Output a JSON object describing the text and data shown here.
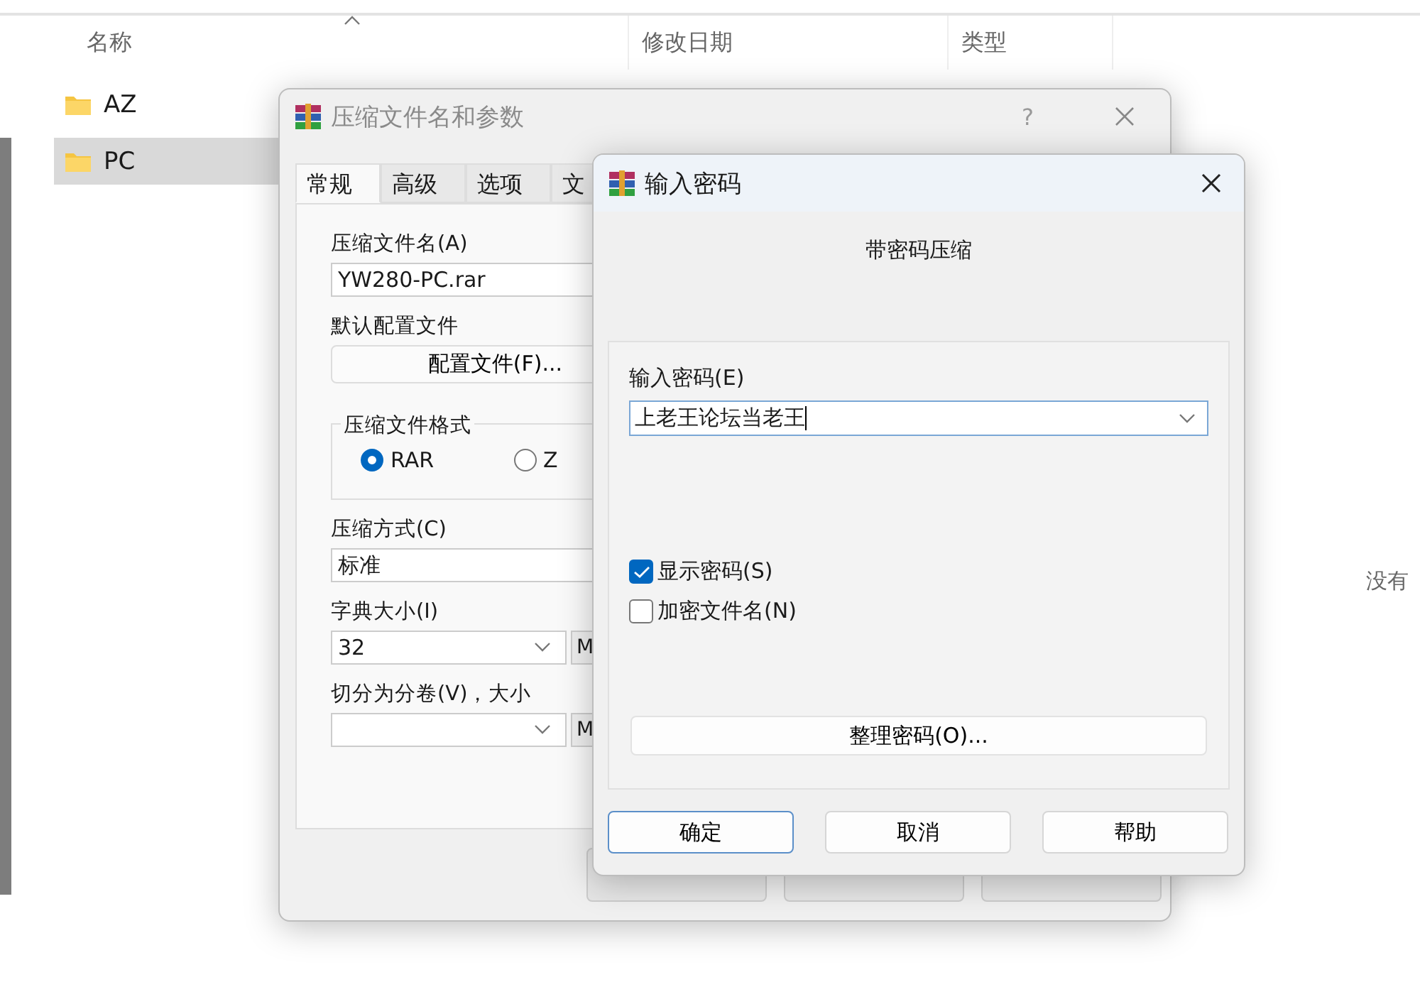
{
  "explorer": {
    "columns": [
      "名称",
      "修改日期",
      "类型"
    ],
    "items": [
      {
        "name": "AZ",
        "selected": false
      },
      {
        "name": "PC",
        "selected": true
      }
    ],
    "preview_text": "没有"
  },
  "archive_dialog": {
    "title": "压缩文件名和参数",
    "help": "?",
    "tabs": [
      {
        "label": "常规",
        "selected": true
      },
      {
        "label": "高级",
        "selected": false
      },
      {
        "label": "选项",
        "selected": false
      },
      {
        "label": "文",
        "selected": false
      }
    ],
    "archive_name_label": "压缩文件名(A)",
    "archive_name": "YW280-PC.rar",
    "profile_label": "默认配置文件",
    "profile_button": "配置文件(F)...",
    "format_group": "压缩文件格式",
    "formats": [
      {
        "label": "RAR",
        "selected": true
      },
      {
        "label": "Z",
        "selected": false
      }
    ],
    "method_label": "压缩方式(C)",
    "method": "标准",
    "dict_label": "字典大小(I)",
    "dict": "32",
    "dict_unit": "M",
    "split_label": "切分为分卷(V)，大小",
    "split_unit": "M"
  },
  "password_dialog": {
    "title": "输入密码",
    "heading": "带密码压缩",
    "password_label": "输入密码(E)",
    "password": "上老王论坛当老王",
    "options": [
      {
        "label": "显示密码(S)",
        "checked": true
      },
      {
        "label": "加密文件名(N)",
        "checked": false
      }
    ],
    "organize_button": "整理密码(O)...",
    "buttons": [
      {
        "label": "确定",
        "default": true
      },
      {
        "label": "取消",
        "default": false
      },
      {
        "label": "帮助",
        "default": false
      }
    ]
  }
}
